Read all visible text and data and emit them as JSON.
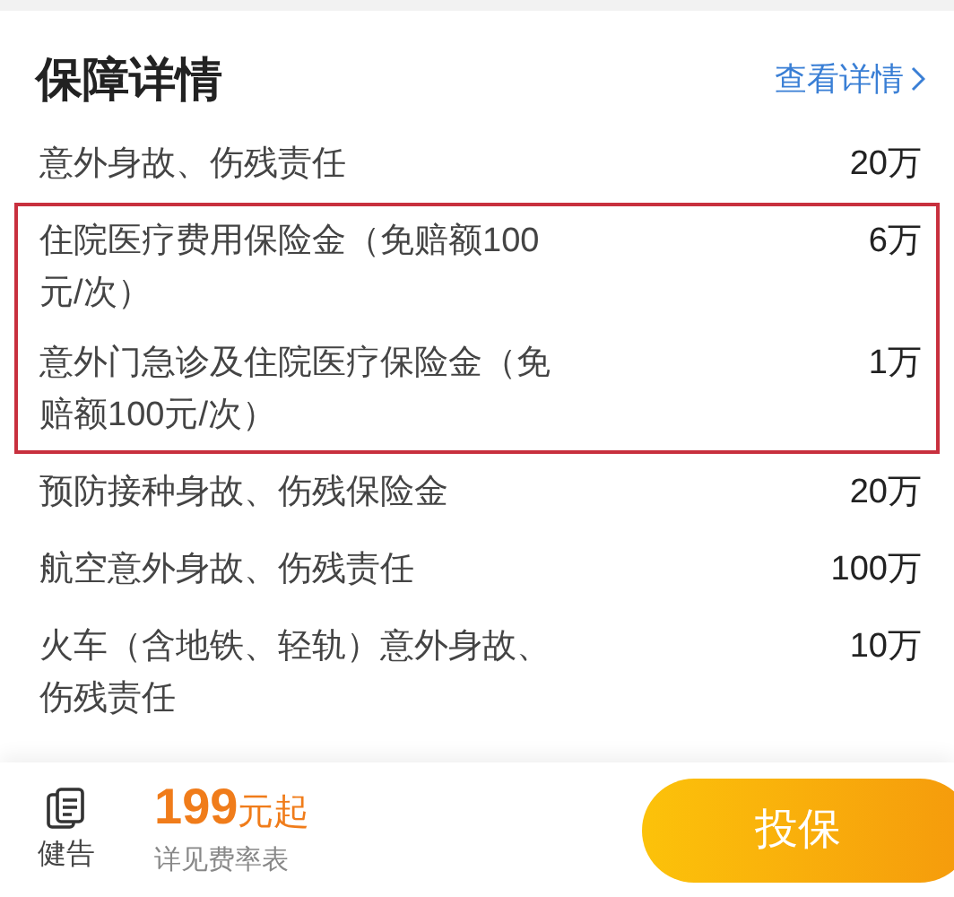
{
  "section": {
    "title": "保障详情",
    "link": "查看详情"
  },
  "rows": [
    {
      "label": "意外身故、伤残责任",
      "amount": "20万",
      "highlighted": false
    },
    {
      "label": "住院医疗费用保险金（免赔额100元/次）",
      "amount": "6万",
      "highlighted": true
    },
    {
      "label": "意外门急诊及住院医疗保险金（免赔额100元/次）",
      "amount": "1万",
      "highlighted": true
    },
    {
      "label": "预防接种身故、伤残保险金",
      "amount": "20万",
      "highlighted": false
    },
    {
      "label": "航空意外身故、伤残责任",
      "amount": "100万",
      "highlighted": false
    },
    {
      "label": "火车（含地铁、轻轨）意外身故、伤残责任",
      "amount": "10万",
      "highlighted": false
    }
  ],
  "footer": {
    "notice": "健告",
    "price": "199",
    "price_unit": "元起",
    "price_note": "详见费率表",
    "buy_button": "投保"
  }
}
